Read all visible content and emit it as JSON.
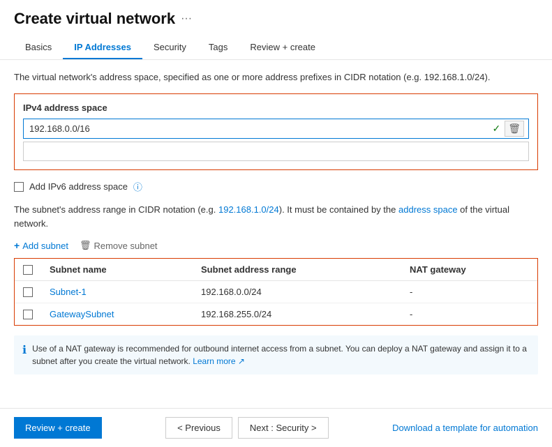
{
  "header": {
    "title": "Create virtual network",
    "ellipsis": "···"
  },
  "tabs": [
    {
      "id": "basics",
      "label": "Basics",
      "active": false
    },
    {
      "id": "ip-addresses",
      "label": "IP Addresses",
      "active": true
    },
    {
      "id": "security",
      "label": "Security",
      "active": false
    },
    {
      "id": "tags",
      "label": "Tags",
      "active": false
    },
    {
      "id": "review-create",
      "label": "Review + create",
      "active": false
    }
  ],
  "content": {
    "description": "The virtual network's address space, specified as one or more address prefixes in CIDR notation (e.g. 192.168.1.0/24).",
    "ipv4_label": "IPv4 address space",
    "ipv4_value": "192.168.0.0/16",
    "ipv6_label": "Add IPv6 address space",
    "subnet_description_1": "The subnet's address range in CIDR notation (e.g. 192.168.1.0/24). It must be contained by the address space of the virtual",
    "subnet_description_2": "network.",
    "add_subnet_label": "+ Add subnet",
    "remove_subnet_label": "Remove subnet",
    "table_headers": [
      "",
      "Subnet name",
      "Subnet address range",
      "NAT gateway"
    ],
    "subnets": [
      {
        "name": "Subnet-1",
        "address_range": "192.168.0.0/24",
        "nat_gateway": "-"
      },
      {
        "name": "GatewaySubnet",
        "address_range": "192.168.255.0/24",
        "nat_gateway": "-"
      }
    ],
    "info_text": "Use of a NAT gateway is recommended for outbound internet access from a subnet. You can deploy a NAT gateway and assign it to a subnet after you create the virtual network.",
    "learn_more": "Learn more"
  },
  "footer": {
    "review_create_label": "Review + create",
    "previous_label": "< Previous",
    "next_label": "Next : Security >",
    "download_label": "Download a template for automation"
  }
}
